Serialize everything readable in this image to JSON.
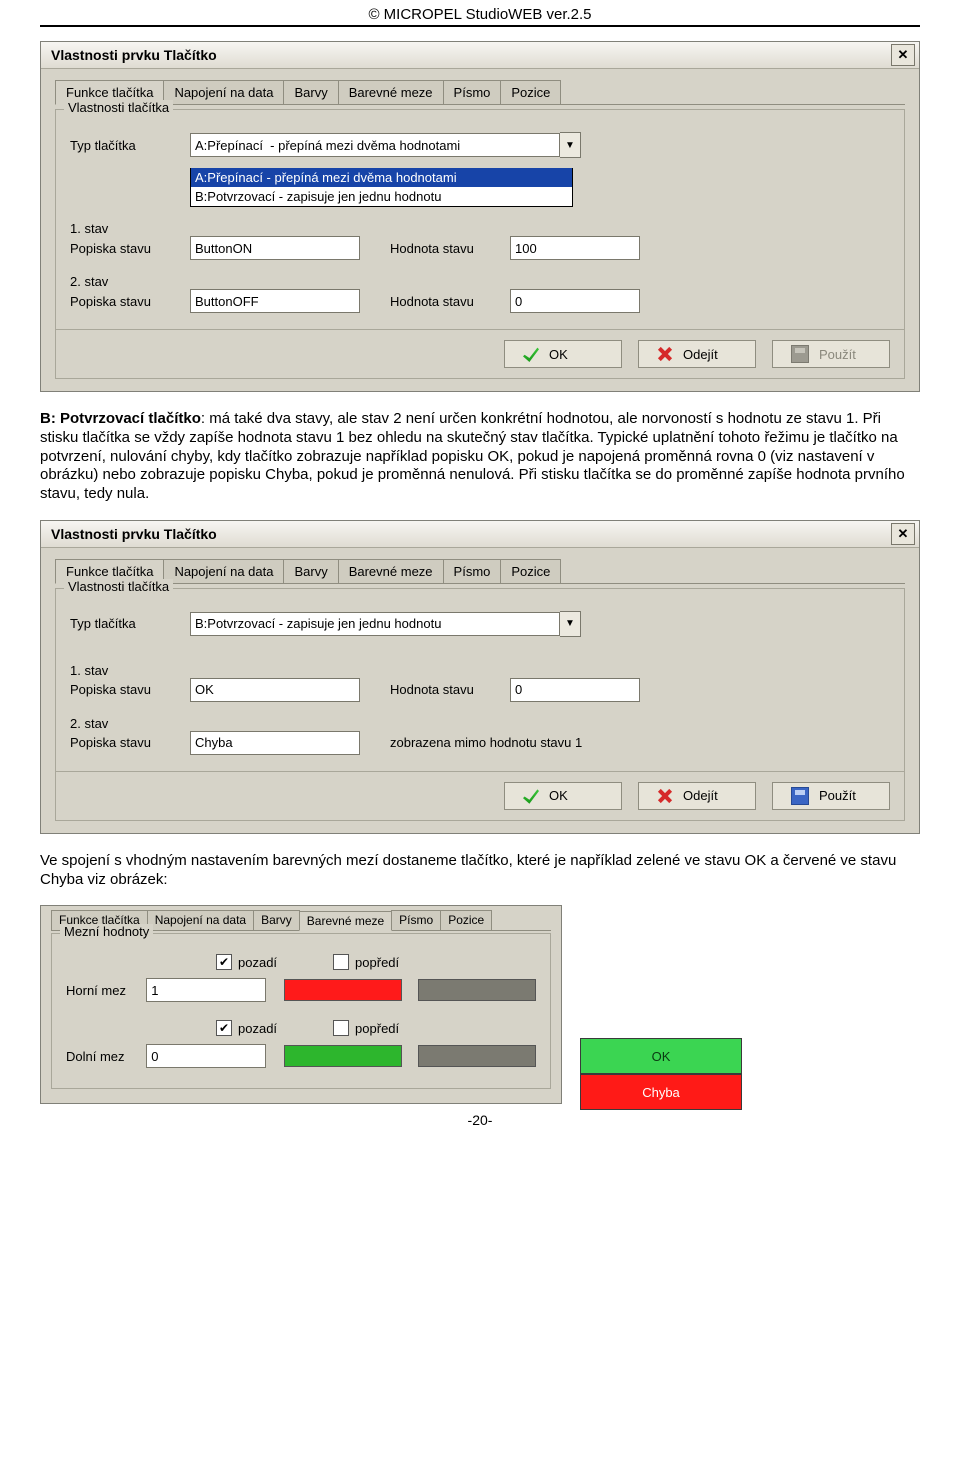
{
  "header": "© MICROPEL StudioWEB  ver.2.5",
  "page_number": "-20-",
  "tabs": [
    "Funkce tlačítka",
    "Napojení na data",
    "Barvy",
    "Barevné meze",
    "Písmo",
    "Pozice"
  ],
  "dialog_title": "Vlastnosti prvku Tlačítko",
  "group_legend": "Vlastnosti tlačítka",
  "labels": {
    "type": "Typ tlačítka",
    "state1": "1. stav",
    "state2": "2. stav",
    "state_caption": "Popiska stavu",
    "state_value": "Hodnota stavu",
    "shown_other": "zobrazena mimo hodnotu stavu 1",
    "ok": "OK",
    "cancel": "Odejít",
    "apply": "Použít"
  },
  "dlg1": {
    "type_selected": "A:Přepínací  - přepíná mezi dvěma hodnotami",
    "options": [
      "A:Přepínací  - přepíná mezi dvěma hodnotami",
      "B:Potvrzovací - zapisuje jen jednu hodnotu"
    ],
    "s1_caption": "ButtonON",
    "s1_value": "100",
    "s2_caption": "ButtonOFF",
    "s2_value": "0"
  },
  "para1_bold": "B: Potvrzovací tlačítko",
  "para1_rest": ": má také dva stavy, ale stav 2 není určen konkrétní hodnotou, ale norvoností s hodnotu ze stavu 1. Při stisku tlačítka se vždy zapíše hodnota stavu 1 bez ohledu na skutečný stav tlačítka. Typické uplatnění tohoto řežimu je tlačítko na potvrzení, nulování chyby, kdy tlačítko zobrazuje například popisku OK, pokud je napojená proměnná rovna 0 (viz nastavení v obrázku) nebo zobrazuje popisku Chyba, pokud je proměnná nenulová. Při stisku tlačítka se do proměnné zapíše hodnota prvního stavu, tedy nula.",
  "dlg2": {
    "type_selected": "B:Potvrzovací - zapisuje jen jednu hodnotu",
    "s1_caption": "OK",
    "s1_value": "0",
    "s2_caption": "Chyba"
  },
  "para2": "Ve spojení s vhodným nastavením barevných mezí dostaneme tlačítko, které je například zelené ve stavu OK a červené ve stavu Chyba viz obrázek:",
  "limits": {
    "legend": "Mezní hodnoty",
    "upper_label": "Horní mez",
    "lower_label": "Dolní mez",
    "upper_value": "1",
    "lower_value": "0",
    "bg": "pozadí",
    "fg": "popředí"
  },
  "status": {
    "ok": "OK",
    "err": "Chyba"
  }
}
